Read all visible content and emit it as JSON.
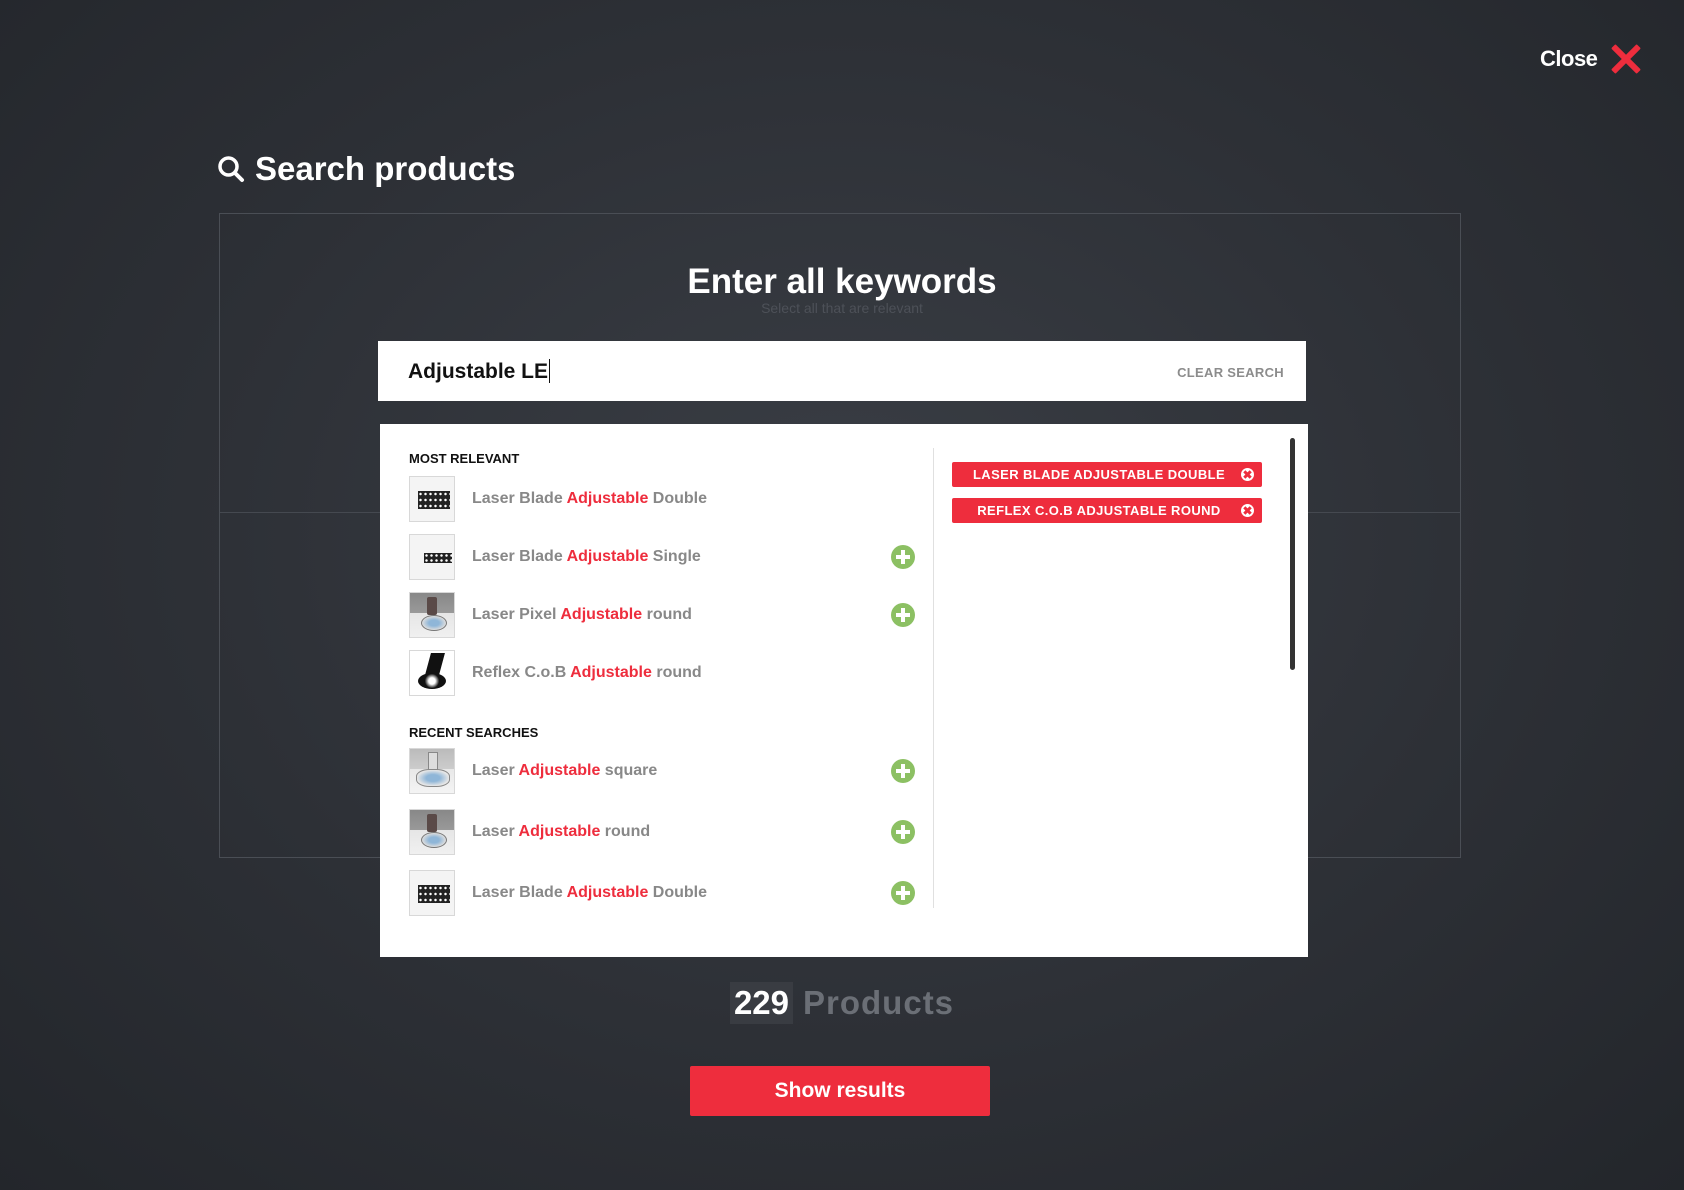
{
  "header": {
    "close_label": "Close",
    "page_title": "Search products"
  },
  "search": {
    "heading": "Enter all keywords",
    "subheading": "Select all that are relevant",
    "value": "Adjustable LE",
    "clear_label": "CLEAR SEARCH"
  },
  "most_relevant": {
    "title": "MOST RELEVANT",
    "items": [
      {
        "pre": "Laser Blade ",
        "hl": "Adjustable",
        "post": " Double",
        "thumb": "blade"
      },
      {
        "pre": "Laser Blade ",
        "hl": "Adjustable",
        "post": " Single",
        "thumb": "single"
      },
      {
        "pre": "Laser Pixel ",
        "hl": "Adjustable",
        "post": " round",
        "thumb": "pixel"
      },
      {
        "pre": "Reflex C.o.B ",
        "hl": "Adjustable",
        "post": " round",
        "thumb": "reflex"
      }
    ]
  },
  "recent_searches": {
    "title": "RECENT SEARCHES",
    "items": [
      {
        "pre": "Laser ",
        "hl": "Adjustable",
        "post": " square",
        "thumb": "square"
      },
      {
        "pre": "Laser ",
        "hl": "Adjustable",
        "post": " round",
        "thumb": "pixel"
      },
      {
        "pre": "Laser Blade ",
        "hl": "Adjustable",
        "post": " Double",
        "thumb": "blade"
      }
    ]
  },
  "selected_tags": [
    "LASER BLADE ADJUSTABLE DOUBLE",
    "REFLEX C.O.B ADJUSTABLE ROUND"
  ],
  "results": {
    "count": "229",
    "count_label": "Products",
    "button_label": "Show results"
  },
  "colors": {
    "accent": "#ee2d3d",
    "add": "#8cc063",
    "background": "#2d3036"
  }
}
